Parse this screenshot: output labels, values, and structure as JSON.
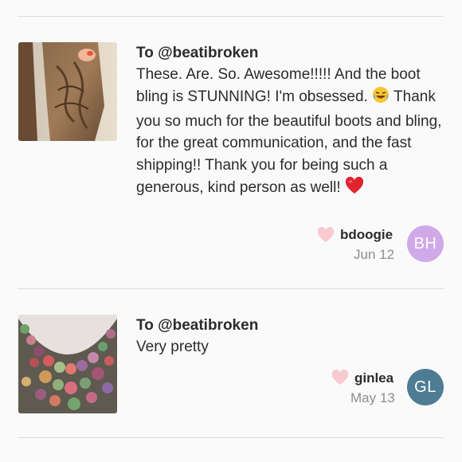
{
  "reviews": [
    {
      "recipient": "To @beatibroken",
      "body_parts": [
        "These. Are. So. Awesome!!!!! And the boot bling is STUNNING! I'm obsessed. ",
        " Thank you so much for the beautiful boots and bling, for the great communication, and the fast shipping!! Thank you for being such a generous, kind person as well! "
      ],
      "emojis": [
        "laughing-tears-emoji",
        "red-heart-emoji"
      ],
      "username": "bdoogie",
      "date": "Jun 12",
      "avatar_initials": "BH",
      "avatar_color": "#d0a9e8",
      "thumbnail": "brown-cowboy-boot-photo"
    },
    {
      "recipient": "To @beatibroken",
      "body": "Very pretty",
      "username": "ginlea",
      "date": "May 13",
      "avatar_initials": "GL",
      "avatar_color": "#4e7c95",
      "thumbnail": "jeweled-bib-necklace-photo"
    }
  ],
  "colors": {
    "like_heart": "#f8c9cf",
    "divider": "#dcdcdc",
    "date_text": "#8d8d8d"
  }
}
